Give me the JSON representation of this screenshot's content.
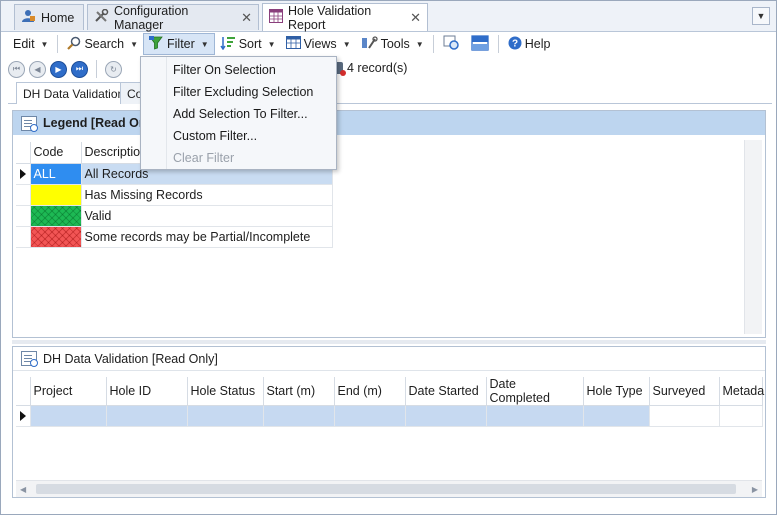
{
  "tabs": [
    {
      "label": "Home",
      "icon": "home-user-icon",
      "closable": false
    },
    {
      "label": "Configuration Manager",
      "icon": "tools-icon",
      "closable": true
    },
    {
      "label": "Hole Validation Report",
      "icon": "report-grid-icon",
      "closable": true,
      "active": true
    }
  ],
  "toolbar": {
    "edit": "Edit",
    "search": "Search",
    "filter": "Filter",
    "sort": "Sort",
    "views": "Views",
    "tools": "Tools",
    "help": "Help"
  },
  "records": "4 record(s)",
  "subtabs": {
    "dh": "DH Data Validation",
    "co": "Co"
  },
  "legend": {
    "title": "Legend [Read Only]",
    "columns": [
      "Code",
      "Description"
    ],
    "rows": [
      {
        "code": "ALL",
        "description": "All Records",
        "swatch": "#2f8df0"
      },
      {
        "code": "",
        "description": "Has Missing Records",
        "swatch": "#ffff00"
      },
      {
        "code": "",
        "description": "Valid",
        "swatch": "#1db954"
      },
      {
        "code": "",
        "description": "Some records may be Partial/Incomplete",
        "swatch": "#f25555"
      }
    ]
  },
  "dh": {
    "title": "DH Data Validation [Read Only]",
    "columns": [
      "Project",
      "Hole ID",
      "Hole Status",
      "Start (m)",
      "End (m)",
      "Date Started",
      "Date Completed",
      "Hole Type",
      "Surveyed",
      "Metada"
    ]
  },
  "filter_menu": {
    "items": [
      {
        "label": "Filter On Selection",
        "enabled": true
      },
      {
        "label": "Filter Excluding Selection",
        "enabled": true
      },
      {
        "label": "Add Selection To Filter...",
        "enabled": true
      },
      {
        "label": "Custom Filter...",
        "enabled": true
      },
      {
        "label": "Clear Filter",
        "enabled": false
      }
    ]
  },
  "colors": {
    "accent": "#2f6dc9",
    "header_blue": "#bdd5ef",
    "selection": "#c6d9f1"
  }
}
